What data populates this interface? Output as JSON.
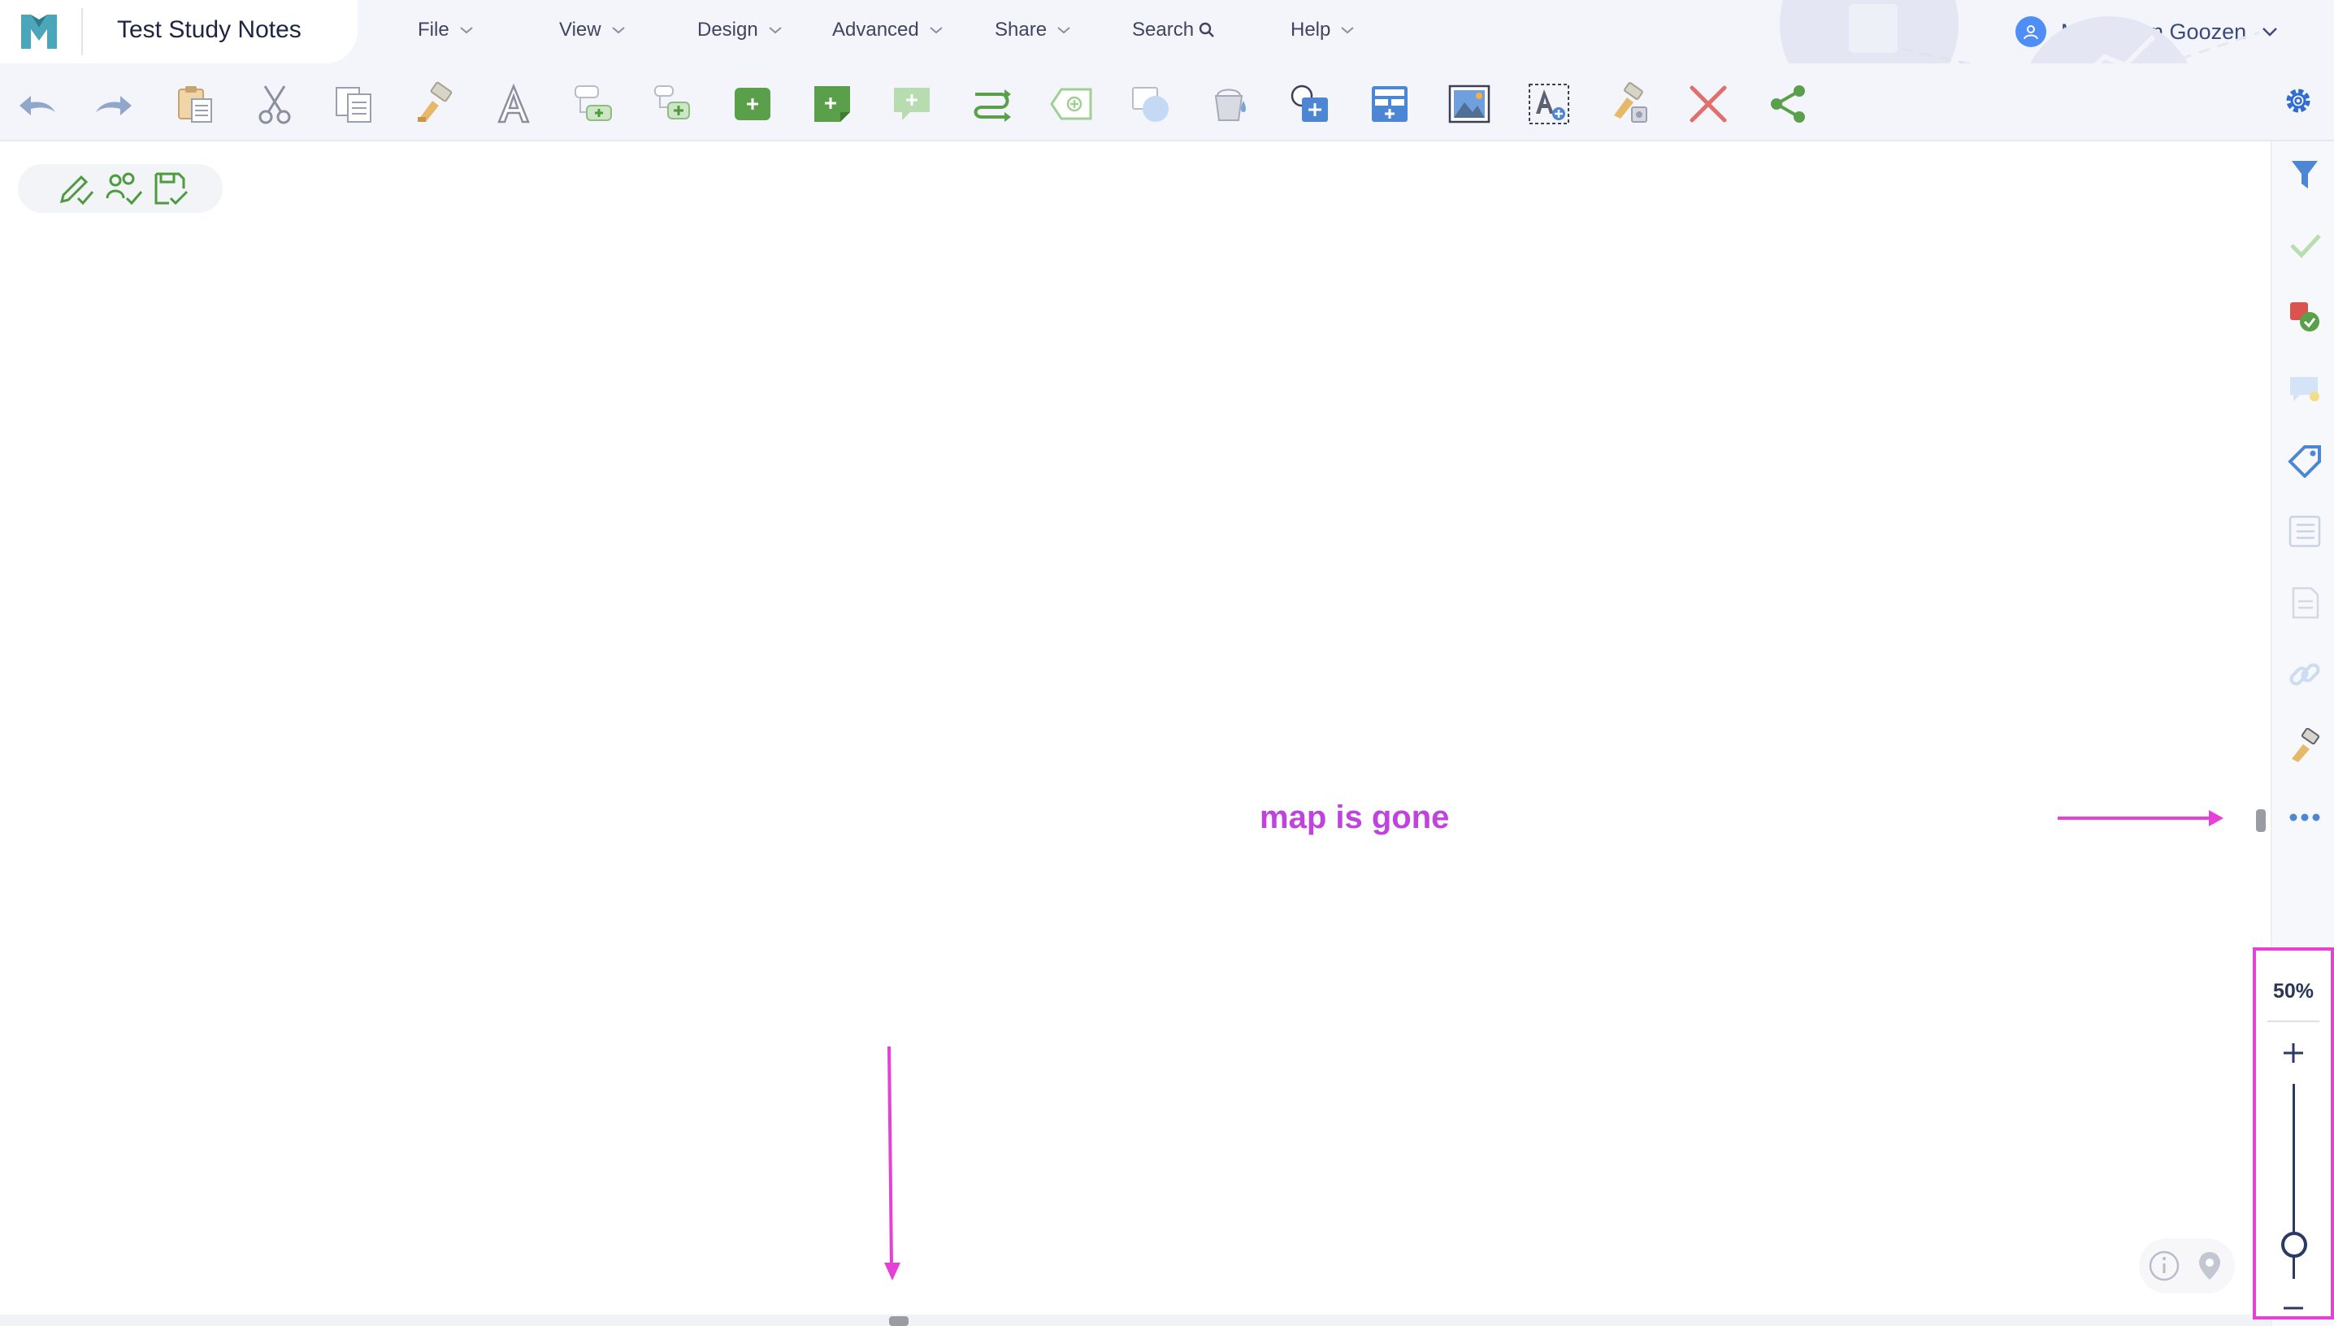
{
  "app": {
    "document_title": "Test Study Notes",
    "logo_icon": "mindmap-logo-icon"
  },
  "menu": {
    "items": [
      {
        "label": "File",
        "has_dropdown": true
      },
      {
        "label": "View",
        "has_dropdown": true
      },
      {
        "label": "Design",
        "has_dropdown": true
      },
      {
        "label": "Advanced",
        "has_dropdown": true
      },
      {
        "label": "Share",
        "has_dropdown": true
      },
      {
        "label": "Search",
        "has_dropdown": false,
        "icon": "search-icon"
      },
      {
        "label": "Help",
        "has_dropdown": true
      }
    ]
  },
  "user": {
    "name": "Marco van Goozen",
    "avatar_icon": "user-avatar-icon"
  },
  "toolbar": {
    "icons": [
      "undo-icon",
      "redo-icon",
      "paste-icon",
      "cut-icon",
      "copy-icon",
      "format-painter-icon",
      "text-icon",
      "add-subtopic-icon",
      "add-topic-icon",
      "add-box-icon",
      "add-note-icon",
      "add-callout-icon",
      "add-relationship-icon",
      "add-tag-icon",
      "shape-icon",
      "fill-bucket-icon",
      "insert-shape-icon",
      "insert-table-icon",
      "insert-image-icon",
      "insert-textbox-icon",
      "clear-format-icon",
      "delete-icon",
      "share-icon"
    ],
    "settings_icon": "gear-icon"
  },
  "canvas_tools": {
    "icons": [
      "edit-check-icon",
      "users-check-icon",
      "save-check-icon"
    ]
  },
  "annotation": {
    "text": "map is gone",
    "color": "#c043e0",
    "highlight_color": "#e640d6"
  },
  "sidebar": {
    "icons": [
      "filter-icon",
      "check-icon",
      "task-icon",
      "comment-icon",
      "tag-icon",
      "list-icon",
      "notes-icon",
      "link-icon",
      "format-icon",
      "more-icon"
    ]
  },
  "zoom": {
    "level_label": "50%",
    "level": 0.5
  },
  "colors": {
    "accent_green": "#5aa04a",
    "accent_blue": "#3f7fd6",
    "text_dark": "#1e2540",
    "annotation": "#c043e0"
  }
}
